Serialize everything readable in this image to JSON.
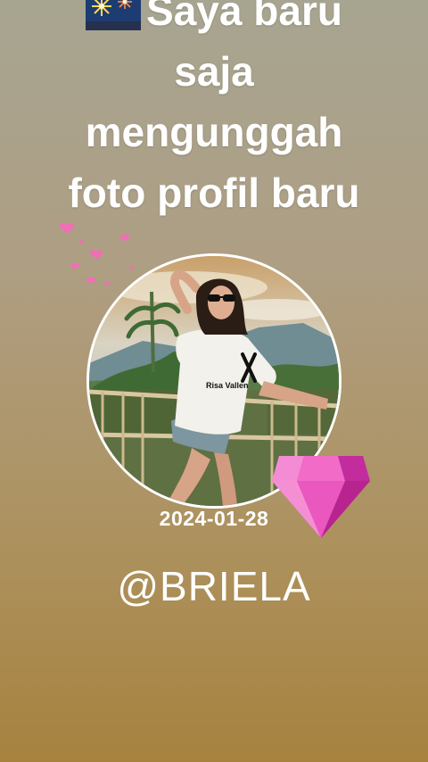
{
  "post": {
    "headline_lines": [
      "Saya baru",
      "saja",
      "mengunggah",
      "foto profil baru"
    ],
    "headline_icon": "firework-icon",
    "profile_photo": {
      "icon": "profile-photo",
      "shirt_text": "Risa Vallen"
    },
    "date": "2024-01-28",
    "username": "@BRIELA",
    "decorations": [
      "heart-sparkles-icon",
      "pink-diamond-heart-icon"
    ]
  },
  "colors": {
    "background_top": "#a7a591",
    "background_bottom": "#a7823f",
    "text": "#ffffff",
    "heart_pink": "#f06fb4"
  }
}
